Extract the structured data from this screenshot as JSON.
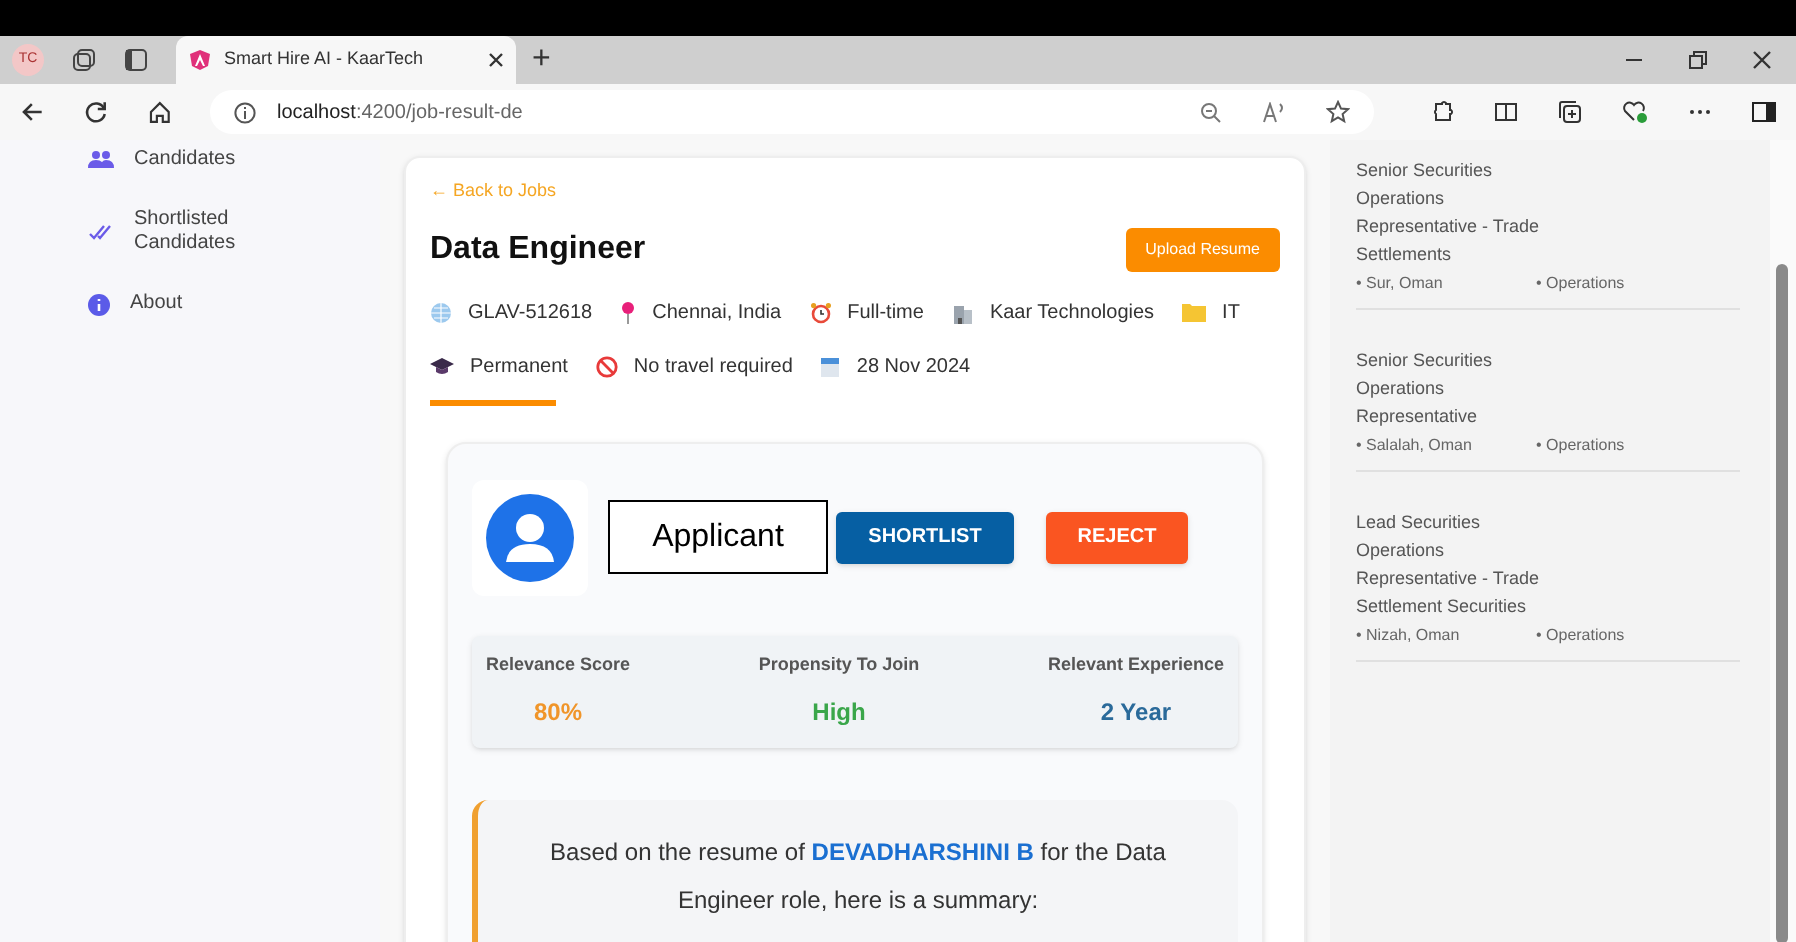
{
  "browser": {
    "profile": "TC",
    "tab_title": "Smart Hire AI - KaarTech",
    "new_tab": "+",
    "url_host": "localhost",
    "url_rest": ":4200/job-result-de"
  },
  "sidebar": {
    "items": [
      {
        "label": "Candidates"
      },
      {
        "label": "Shortlisted Candidates"
      },
      {
        "label": "About"
      }
    ]
  },
  "job": {
    "back_link": "← Back to Jobs",
    "title": "Data Engineer",
    "upload_button": "Upload Resume",
    "meta": [
      "GLAV-512618",
      "Chennai, India",
      "Full-time",
      "Kaar Technologies",
      "IT",
      "Permanent",
      "No travel required",
      "28 Nov 2024"
    ]
  },
  "applicant": {
    "name_label": "Applicant",
    "shortlist_button": "SHORTLIST",
    "reject_button": "REJECT"
  },
  "metrics": [
    {
      "label": "Relevance Score",
      "value": "80%",
      "color": "#f0952a"
    },
    {
      "label": "Propensity To Join",
      "value": "High",
      "color": "#3aa64a"
    },
    {
      "label": "Relevant Experience",
      "value": "2 Year",
      "color": "#2a6a9a"
    }
  ],
  "summary": "Based on the resume of **DEVADHARSHINI B** for the Data Engineer role, here is a summary:",
  "related_jobs": [
    {
      "title": "Senior Securities Operations Representative - Trade Settlements",
      "location": "• Sur, Oman",
      "category": "• Operations"
    },
    {
      "title": "Senior Securities Operations Representative",
      "location": "• Salalah, Oman",
      "category": "• Operations"
    },
    {
      "title": "Lead Securities Operations Representative - Trade Settlement Securities",
      "location": "• Nizah, Oman",
      "category": "• Operations"
    }
  ]
}
